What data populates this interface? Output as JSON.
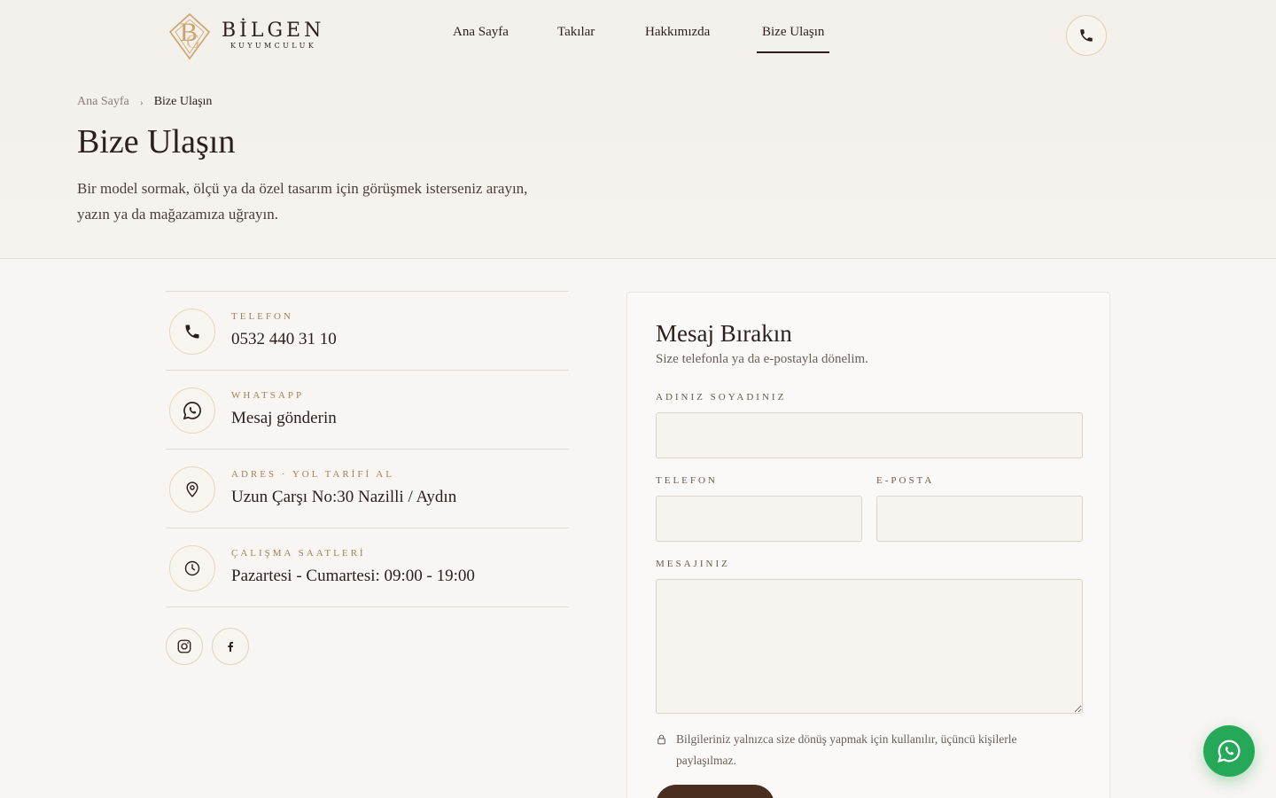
{
  "brand": {
    "name": "BİLGEN",
    "sub": "KUYUMCULUK",
    "accent": "#c9a46c"
  },
  "nav": {
    "items": [
      {
        "label": "Ana Sayfa"
      },
      {
        "label": "Takılar"
      },
      {
        "label": "Hakkımızda"
      },
      {
        "label": "Bize Ulaşın",
        "active": true
      }
    ]
  },
  "breadcrumb": {
    "home": "Ana Sayfa",
    "separator": "›",
    "current": "Bize Ulaşın"
  },
  "page": {
    "title": "Bize Ulaşın",
    "description": "Bir model sormak, ölçü ya da özel tasarım için görüşmek isterseniz arayın, yazın ya da mağazamıza uğrayın."
  },
  "contacts": [
    {
      "icon": "phone-icon",
      "label": "TELEFON",
      "value": "0532 440 31 10"
    },
    {
      "icon": "whatsapp-icon",
      "label": "WHATSAPP",
      "value": "Mesaj gönderin"
    },
    {
      "icon": "location-pin-icon",
      "label": "ADRES · YOL TARİFİ AL",
      "value": "Uzun Çarşı No:30 Nazilli / Aydın"
    },
    {
      "icon": "clock-icon",
      "label": "ÇALIŞMA SAATLERİ",
      "value": "Pazartesi - Cumartesi: 09:00 - 19:00"
    }
  ],
  "socials": [
    {
      "icon": "instagram-icon"
    },
    {
      "icon": "facebook-icon"
    }
  ],
  "form": {
    "title": "Mesaj Bırakın",
    "subtitle": "Size telefonla ya da e-postayla dönelim.",
    "name_label": "ADINIZ SOYADINIZ",
    "phone_label": "TELEFON",
    "email_label": "E-POSTA",
    "message_label": "MESAJINIZ",
    "name_value": "",
    "phone_value": "",
    "email_value": "",
    "message_value": "",
    "privacy": "Bilgileriniz yalnızca size dönüş yapmak için kullanılır, üçüncü kişilerle paylaşılmaz.",
    "submit_label": ""
  },
  "colors": {
    "whatsapp": "#25a959",
    "button": "#4a2f20",
    "gold": "#a3825d"
  }
}
